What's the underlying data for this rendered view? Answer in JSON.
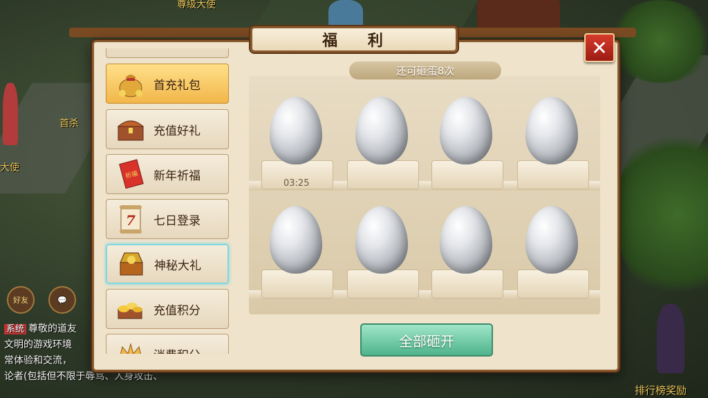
{
  "window": {
    "title": "福 利",
    "close_label": "✕"
  },
  "background": {
    "labels": [
      "尊级大使",
      "首杀",
      "大使",
      "排行榜奖励",
      "好友"
    ],
    "chat": {
      "system_tag": "系统",
      "lines": [
        "尊敬的道友",
        "文明的游戏环境",
        "常体验和交流，",
        "论者(包括但不限于辱骂、人身攻击、"
      ]
    }
  },
  "sidebar": {
    "items": [
      {
        "label": "首充礼包",
        "icon": "money-bag-icon",
        "state": "selected"
      },
      {
        "label": "充值好礼",
        "icon": "treasure-chest-icon",
        "state": "normal"
      },
      {
        "label": "新年祈福",
        "icon": "red-envelope-icon",
        "state": "normal",
        "icon_text": "祈福"
      },
      {
        "label": "七日登录",
        "icon": "calendar-scroll-icon",
        "state": "normal",
        "icon_text": "7"
      },
      {
        "label": "神秘大礼",
        "icon": "gold-chest-icon",
        "state": "highlighted"
      },
      {
        "label": "充值积分",
        "icon": "gold-ingots-icon",
        "state": "normal"
      },
      {
        "label": "消费积分",
        "icon": "crown-icon",
        "state": "partially-visible"
      }
    ]
  },
  "main": {
    "counter_text": "还可砸蛋8次",
    "timer_text": "03:25",
    "eggs_count": 8,
    "smash_all_label": "全部砸开"
  },
  "colors": {
    "accent_selected": "#f2b64a",
    "highlight_border": "#7fd7e0",
    "button_green": "#4fb38c",
    "close_red": "#c0322a"
  }
}
